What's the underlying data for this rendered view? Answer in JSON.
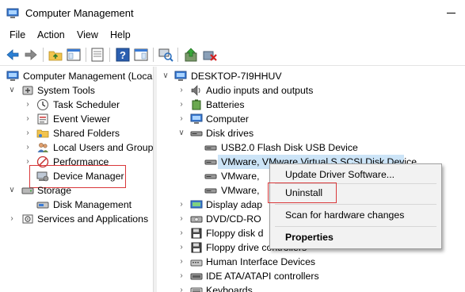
{
  "window": {
    "title": "Computer Management",
    "colors": {
      "accent": "#0078d7",
      "selection": "#cce4f7",
      "annotation": "#d9383a"
    }
  },
  "menu": [
    "File",
    "Action",
    "View",
    "Help"
  ],
  "toolbar": {
    "icons": [
      "back-arrow-icon",
      "forward-arrow-icon",
      "folder-up-icon",
      "show-tree-icon",
      "properties-icon",
      "help-icon",
      "show-action-pane-icon",
      "scan-hardware-icon",
      "update-driver-icon",
      "disable-device-icon"
    ]
  },
  "left_tree": {
    "root": "Computer Management (Local",
    "system_tools": "System Tools",
    "task_scheduler": "Task Scheduler",
    "event_viewer": "Event Viewer",
    "shared_folders": "Shared Folders",
    "local_users": "Local Users and Groups",
    "performance": "Performance",
    "device_manager": "Device Manager",
    "storage": "Storage",
    "disk_management": "Disk Management",
    "services": "Services and Applications"
  },
  "device_tree": {
    "computer_name": "DESKTOP-7I9HHUV",
    "audio": "Audio inputs and outputs",
    "batteries": "Batteries",
    "computer": "Computer",
    "disk_drives": "Disk drives",
    "usb_flash": "USB2.0 Flash Disk USB Device",
    "vmware_selected": "VMware, VMware Virtual S SCSI Disk Device",
    "vmware_2": "VMware,",
    "vmware_3": "VMware,",
    "display": "Display adap",
    "dvd": "DVD/CD-RO",
    "floppy_disk": "Floppy disk d",
    "floppy_ctrl": "Floppy drive controllers",
    "hid": "Human Interface Devices",
    "ide": "IDE ATA/ATAPI controllers",
    "keyboards": "Keyboards"
  },
  "context_menu": {
    "update": "Update Driver Software...",
    "uninstall": "Uninstall",
    "scan": "Scan for hardware changes",
    "properties": "Properties"
  }
}
